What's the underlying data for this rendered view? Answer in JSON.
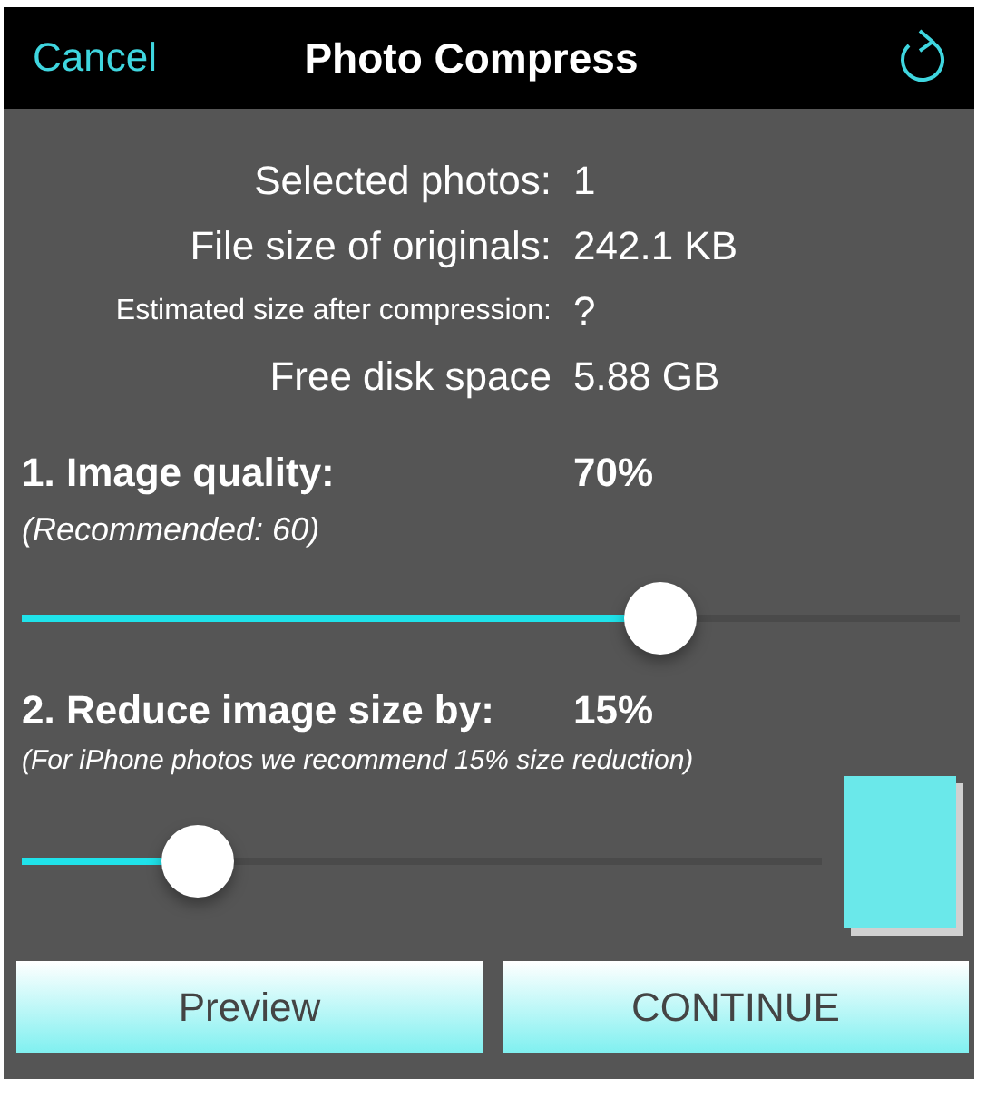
{
  "header": {
    "cancel": "Cancel",
    "title": "Photo Compress"
  },
  "info": [
    {
      "label": "Selected photos:",
      "value": "1",
      "kind": "normal"
    },
    {
      "label": "File size of originals:",
      "value": "242.1 KB",
      "kind": "normal"
    },
    {
      "label": "Estimated size after compression:",
      "value": "?",
      "kind": "small"
    },
    {
      "label": "Free disk space",
      "value": "5.88 GB",
      "kind": "normal"
    }
  ],
  "quality": {
    "heading": "1. Image quality:",
    "value": "70%",
    "note": "(Recommended: 60)",
    "level": 0.68
  },
  "resize": {
    "heading": "2. Reduce image size by:",
    "value": "15%",
    "note": "(For iPhone photos we recommend 15% size reduction)",
    "level": 0.22
  },
  "buttons": [
    "Preview",
    "CONTINUE"
  ]
}
